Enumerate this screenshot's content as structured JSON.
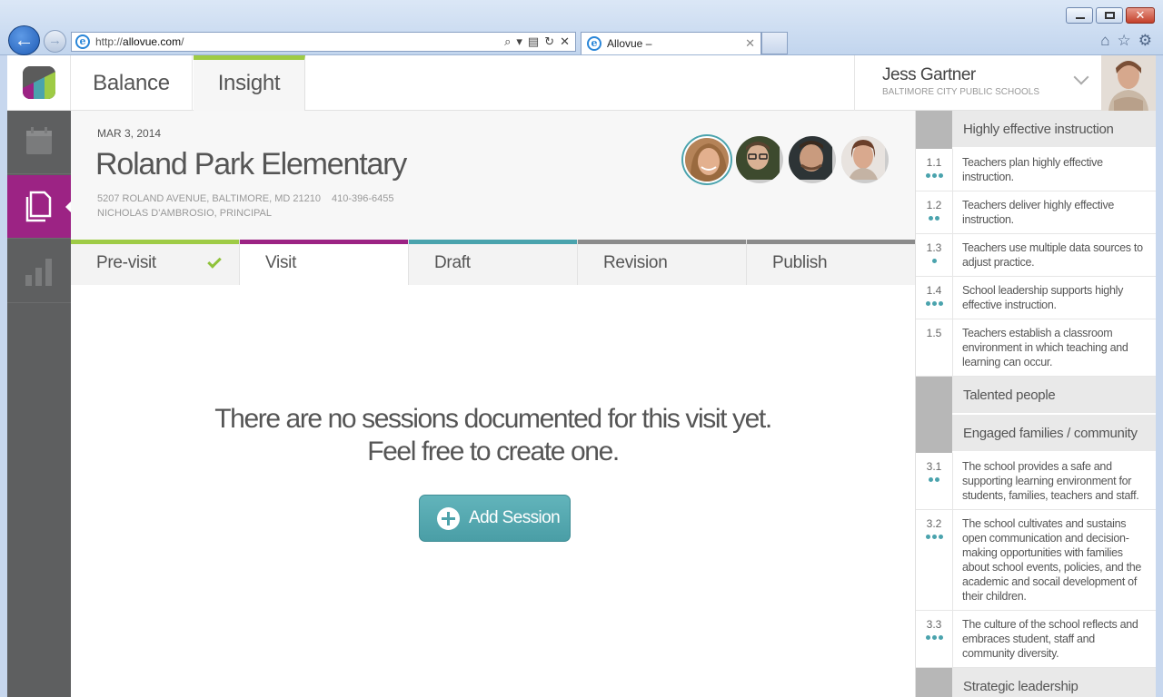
{
  "browser": {
    "url_prefix": "http://",
    "url_host": "allovue.com",
    "url_suffix": "/",
    "tab_title": "Allovue –"
  },
  "app": {
    "tabs": {
      "balance": "Balance",
      "insight": "Insight"
    },
    "user": {
      "name": "Jess Gartner",
      "org": "BALTIMORE CITY PUBLIC SCHOOLS"
    }
  },
  "school": {
    "date": "MAR 3, 2014",
    "name": "Roland Park Elementary",
    "address": "5207 ROLAND AVENUE, BALTIMORE, MD 21210",
    "phone": "410-396-6455",
    "principal": "NICHOLAS D'AMBROSIO, PRINCIPAL"
  },
  "stages": [
    {
      "label": "Pre-visit",
      "color": "#9ecb45",
      "done": true
    },
    {
      "label": "Visit",
      "color": "#9c2384",
      "done": false
    },
    {
      "label": "Draft",
      "color": "#4aa3ad",
      "done": false
    },
    {
      "label": "Revision",
      "color": "#8b8b8b",
      "done": false
    },
    {
      "label": "Publish",
      "color": "#8b8b8b",
      "done": false
    }
  ],
  "empty_state": {
    "line1": "There are no sessions documented for this visit yet.",
    "line2": "Feel free to create one.",
    "button": "Add Session"
  },
  "rubric": [
    {
      "type": "header",
      "title": "Highly effective instruction"
    },
    {
      "type": "item",
      "num": "1.1",
      "dots": 3,
      "text": "Teachers plan highly effective instruction."
    },
    {
      "type": "item",
      "num": "1.2",
      "dots": 2,
      "text": "Teachers deliver highly effective instruction."
    },
    {
      "type": "item",
      "num": "1.3",
      "dots": 1,
      "text": "Teachers use multiple data sources to adjust practice."
    },
    {
      "type": "item",
      "num": "1.4",
      "dots": 3,
      "text": "School leadership supports highly effective instruction."
    },
    {
      "type": "item",
      "num": "1.5",
      "dots": 0,
      "text": "Teachers establish a classroom environment in which teaching and learning can occur."
    },
    {
      "type": "header",
      "title": "Talented people"
    },
    {
      "type": "header",
      "title": "Engaged families / community"
    },
    {
      "type": "item",
      "num": "3.1",
      "dots": 2,
      "text": "The school provides a safe and supporting learning environment for students, families, teachers and staff."
    },
    {
      "type": "item",
      "num": "3.2",
      "dots": 3,
      "text": "The school cultivates and sustains open communication and decision-making opportunities with families about school events, policies, and the academic and socail development of their children."
    },
    {
      "type": "item",
      "num": "3.3",
      "dots": 3,
      "text": "The culture of the school reflects and embraces student, staff and community diversity."
    },
    {
      "type": "header",
      "title": "Strategic leadership"
    }
  ],
  "icons": {
    "back": "back-arrow-icon",
    "forward": "forward-arrow-icon",
    "home": "home-icon",
    "favorites": "star-icon",
    "tools": "gear-icon",
    "calendar": "calendar-icon",
    "documents": "documents-icon",
    "reports": "bar-chart-icon"
  }
}
